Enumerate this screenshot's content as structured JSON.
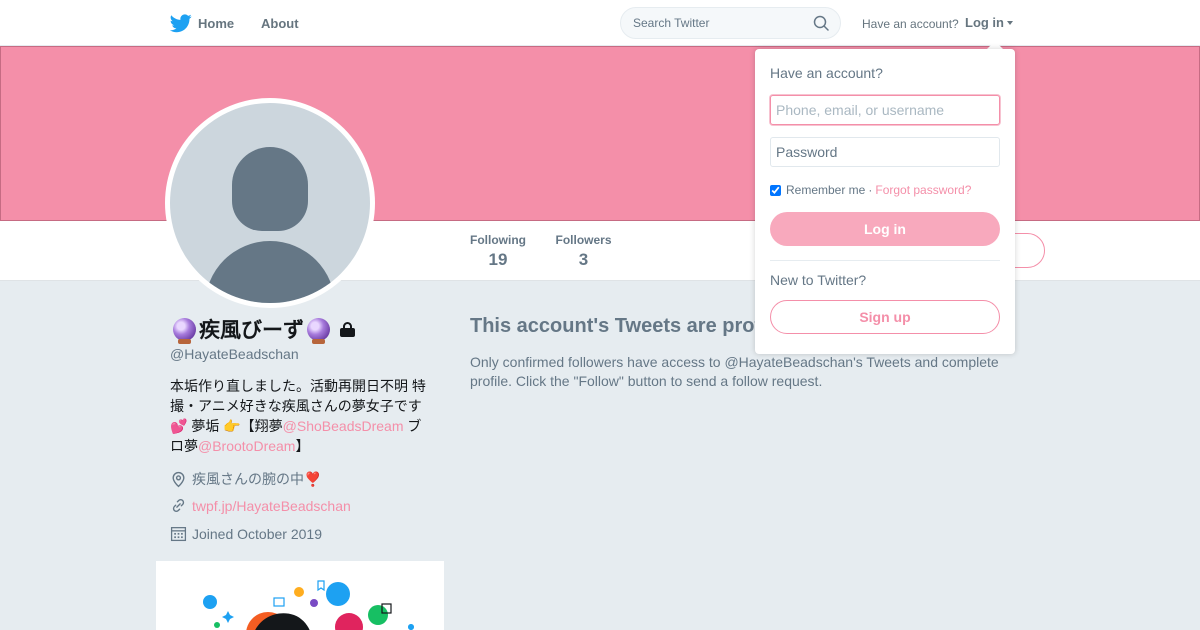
{
  "nav": {
    "home_label": "Home",
    "about_label": "About",
    "search_placeholder": "Search Twitter",
    "have_account": "Have an account?",
    "login_label": "Log in"
  },
  "colors": {
    "accent": "#f48fa9",
    "banner": "#f48fa9",
    "twitter_blue": "#1da1f2",
    "page_bg": "#e6ecf0"
  },
  "profile": {
    "name": "疾風びーず",
    "handle": "@HayateBeadschan",
    "bio": {
      "line1": "本垢作り直しました。活動再開日不明 特撮・アニメ好きな疾風さんの夢女子です",
      "heart_emoji": "💕",
      "dream_label": " 夢垢 ",
      "point_emoji": "👉",
      "sho_prefix": "【翔夢",
      "sho_link": "@ShoBeadsDream",
      "bro_prefix": " ブロ夢",
      "bro_link": "@BrootoDream",
      "suffix": "】"
    },
    "location": "疾風さんの腕の中",
    "location_emoji": "❣️",
    "url": "twpf.jp/HayateBeadschan",
    "joined": "Joined October 2019"
  },
  "stats": {
    "following_label": "Following",
    "following_value": "19",
    "followers_label": "Followers",
    "followers_value": "3"
  },
  "protected": {
    "title": "This account's Tweets are protected.",
    "description": "Only confirmed followers have access to @HayateBeadschan's Tweets and complete profile. Click the \"Follow\" button to send a follow request."
  },
  "login_dropdown": {
    "title": "Have an account?",
    "username_placeholder": "Phone, email, or username",
    "password_placeholder": "Password",
    "remember_label": "Remember me",
    "separator": "·",
    "forgot_label": "Forgot password?",
    "login_button": "Log in",
    "new_label": "New to Twitter?",
    "signup_button": "Sign up"
  }
}
